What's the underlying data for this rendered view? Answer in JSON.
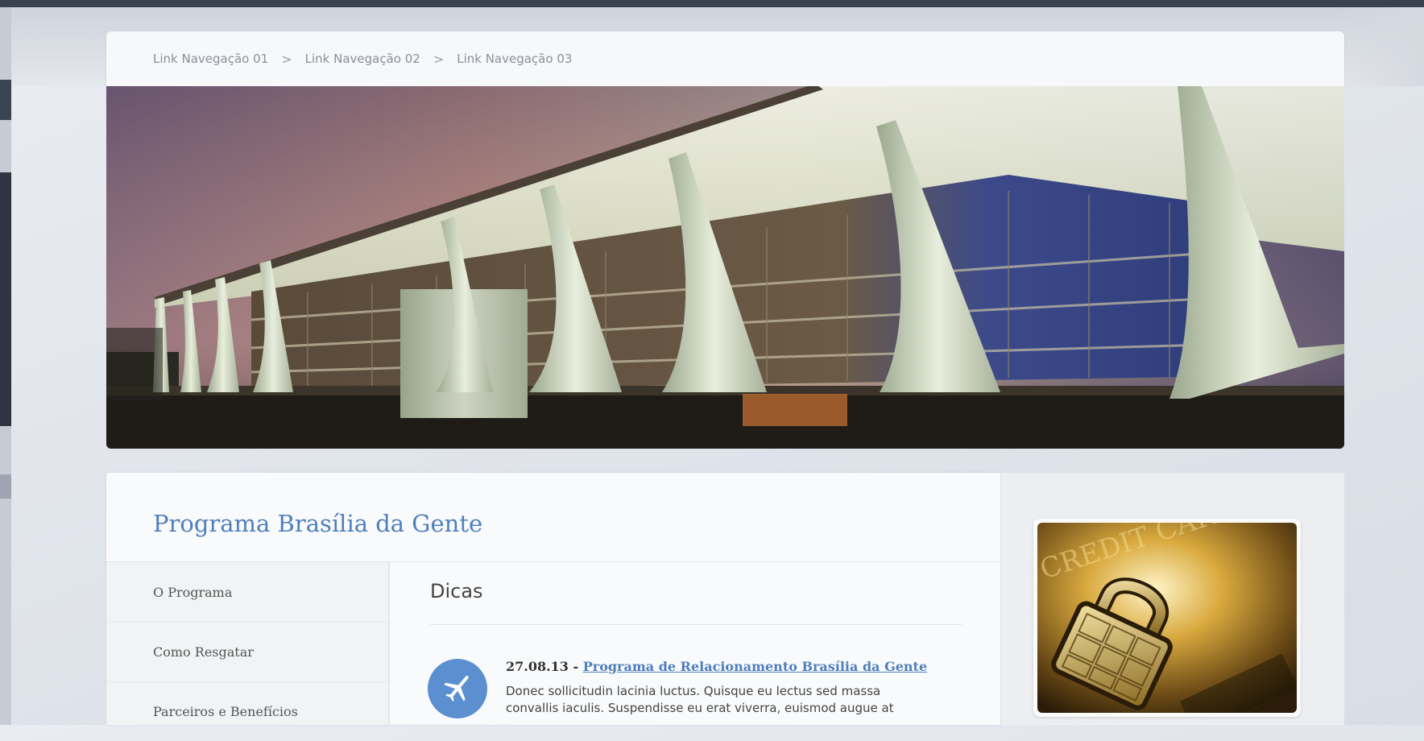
{
  "breadcrumb": {
    "items": [
      "Link Navegação 01",
      "Link Navegação 02",
      "Link Navegação 03"
    ],
    "separator": ">"
  },
  "hero": {
    "image": "palace-columns-photo"
  },
  "program": {
    "title": "Programa Brasília da Gente"
  },
  "nav": {
    "items": [
      "O Programa",
      "Como Resgatar",
      "Parceiros e Benefícios"
    ]
  },
  "dicas": {
    "title": "Dicas",
    "items": [
      {
        "date": "27.08.13 -",
        "link": "Programa de Relacionamento Brasília da Gente",
        "text": "Donec sollicitudin lacinia luctus. Quisque eu lectus sed massa convallis iaculis. Suspendisse eu erat viverra, euismod augue at",
        "icon": "airplane-icon"
      }
    ]
  },
  "promo": {
    "image": "credit-card-lock-image",
    "card_text": "CREDIT CARD"
  },
  "colors": {
    "accent": "#4e7fbd",
    "icon_bg": "#5b8fcf"
  }
}
